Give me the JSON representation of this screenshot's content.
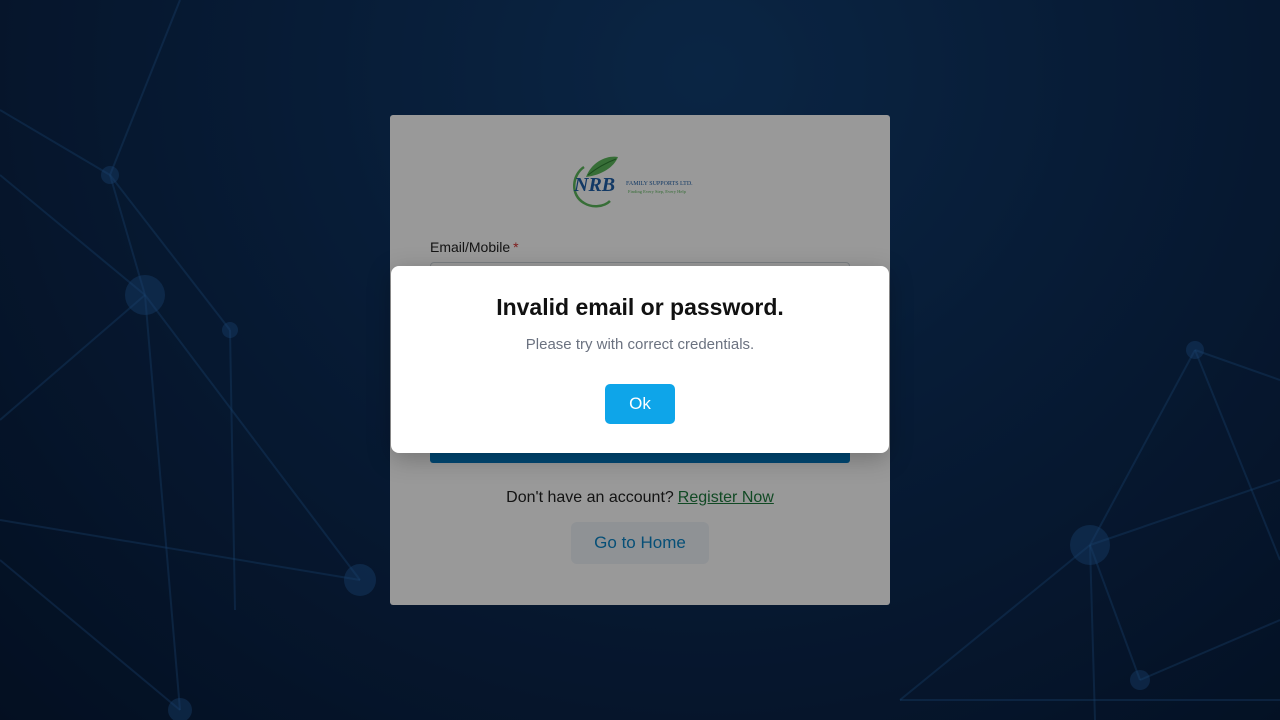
{
  "logo": {
    "brand": "NRB",
    "line1": "FAMILY SUPPORTS LTD.",
    "line2": "Finding Every Step, Every Help"
  },
  "form": {
    "email_label": "Email/Mobile",
    "required_mark": "*",
    "register_prompt": "Don't have an account?",
    "register_link": "Register Now",
    "home_button": "Go to Home"
  },
  "dialog": {
    "title": "Invalid email or password.",
    "message": "Please try with correct credentials.",
    "ok_button": "Ok"
  },
  "colors": {
    "accent": "#0ea5e9",
    "primary_button": "#0079c0",
    "link": "#1d7a3c",
    "background": "#0c2d58"
  }
}
